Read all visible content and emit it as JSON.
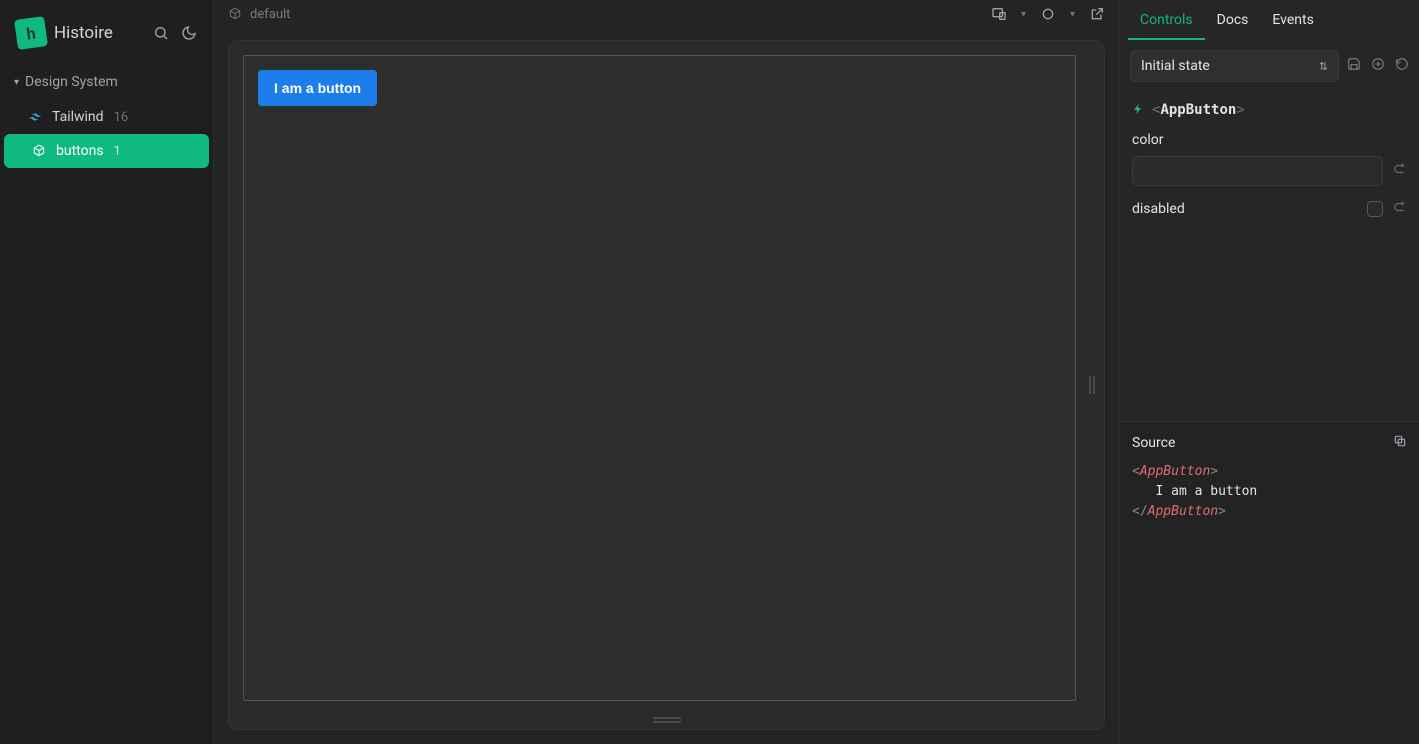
{
  "brand": {
    "name": "Histoire",
    "logo_glyph": "h"
  },
  "sidebar": {
    "group_label": "Design System",
    "items": [
      {
        "label": "Tailwind",
        "count": "16",
        "icon": "tailwind-icon"
      },
      {
        "label": "buttons",
        "count": "1",
        "icon": "cube-icon"
      }
    ]
  },
  "story": {
    "variant_label": "default",
    "button_text": "I am a button"
  },
  "panel": {
    "tabs": {
      "controls": "Controls",
      "docs": "Docs",
      "events": "Events"
    },
    "state_select_label": "Initial state",
    "component_name": "AppButton",
    "controls": {
      "color": {
        "label": "color",
        "value": ""
      },
      "disabled": {
        "label": "disabled",
        "checked": false
      }
    }
  },
  "source": {
    "header": "Source",
    "tag_name": "AppButton",
    "inner_text": "I am a button"
  }
}
